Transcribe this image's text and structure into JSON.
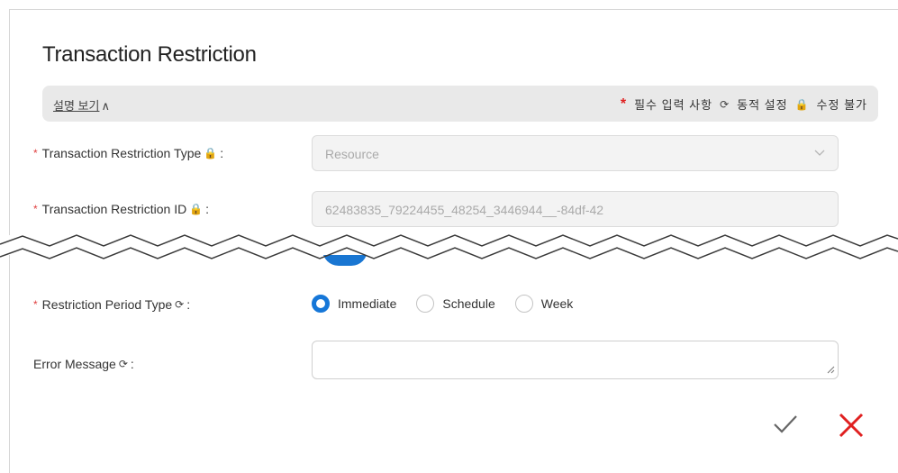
{
  "dialog": {
    "title": "Transaction Restriction"
  },
  "info_bar": {
    "desc_toggle": "설명 보기",
    "desc_chevron": "∧",
    "required_star": "*",
    "required_label": "필수 입력 사항",
    "dynamic_icon": "refresh-icon",
    "dynamic_label": "동적 설정",
    "lock_icon": "lock-icon",
    "readonly_label": "수정 불가"
  },
  "fields": {
    "type": {
      "star": "*",
      "label": "Transaction Restriction Type",
      "lock": "🔒",
      "colon": ":",
      "value": "Resource"
    },
    "id": {
      "star": "*",
      "label": "Transaction Restriction ID",
      "lock": "🔒",
      "colon": ":",
      "value": "62483835_79224455_48254_3446944__-84df-42"
    },
    "period": {
      "star": "*",
      "label": "Restriction Period Type",
      "dyn": "⟳",
      "colon": ":",
      "options": [
        "Immediate",
        "Schedule",
        "Week"
      ],
      "selected": "Immediate"
    },
    "error": {
      "label": "Error Message",
      "dyn": "⟳",
      "colon": ":",
      "value": ""
    }
  },
  "actions": {
    "confirm_icon": "check-icon",
    "cancel_icon": "close-icon"
  },
  "colors": {
    "accent": "#1677d8",
    "required": "#e02020",
    "cancel": "#e02020",
    "confirm": "#666666"
  }
}
